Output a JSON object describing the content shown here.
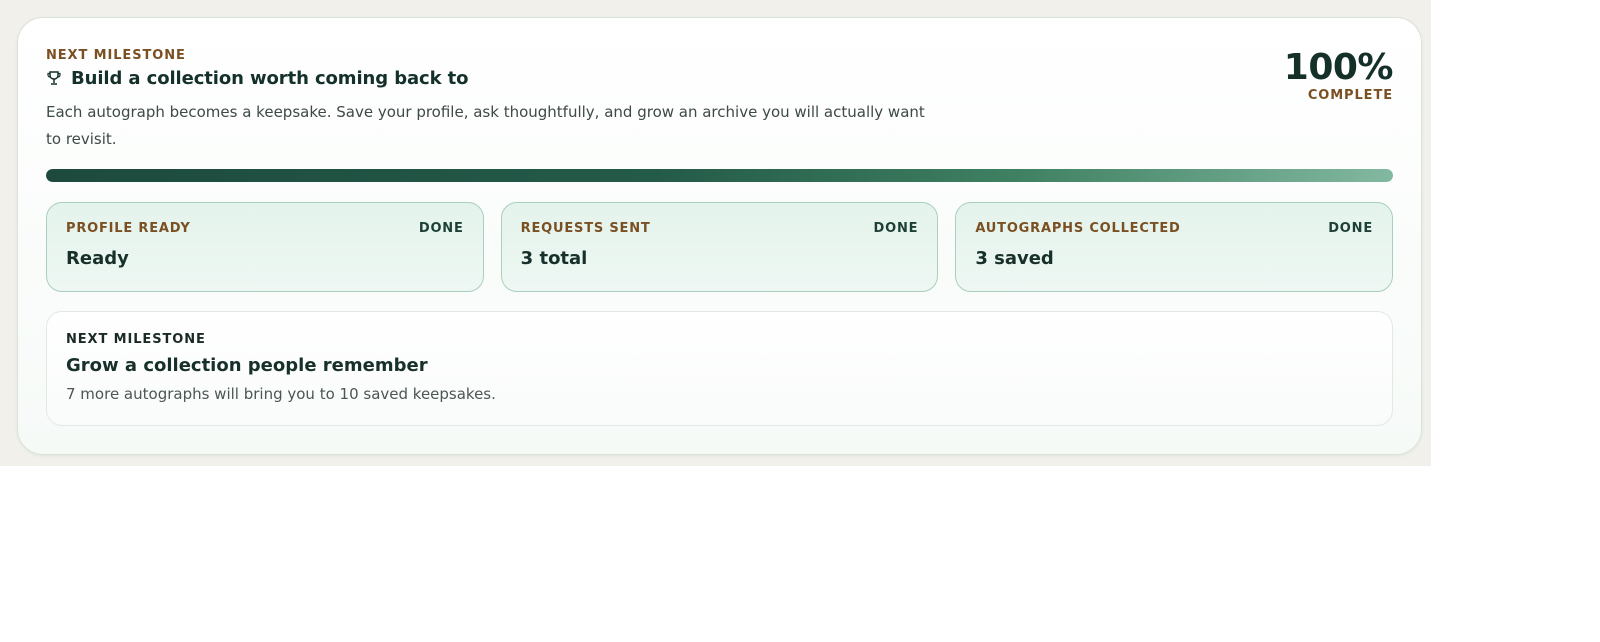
{
  "milestone": {
    "eyebrow": "NEXT MILESTONE",
    "icon": "trophy-icon",
    "title": "Build a collection worth coming back to",
    "description": "Each autograph becomes a keepsake. Save your profile, ask thoughtfully, and grow an archive you will actually want to revisit.",
    "percent_text": "100%",
    "percent_label": "COMPLETE",
    "progress": 1.0
  },
  "stats": [
    {
      "label": "PROFILE READY",
      "status": "DONE",
      "value": "Ready"
    },
    {
      "label": "REQUESTS SENT",
      "status": "DONE",
      "value": "3 total"
    },
    {
      "label": "AUTOGRAPHS COLLECTED",
      "status": "DONE",
      "value": "3 saved"
    }
  ],
  "next": {
    "eyebrow": "NEXT MILESTONE",
    "title": "Grow a collection people remember",
    "description": "7 more autographs will bring you to 10 saved keepsakes."
  },
  "colors": {
    "accent_brown": "#7a4f22",
    "deep_green": "#1d4a3d",
    "light_green": "#82b8a0",
    "stat_bg": "#e4f3ec"
  }
}
